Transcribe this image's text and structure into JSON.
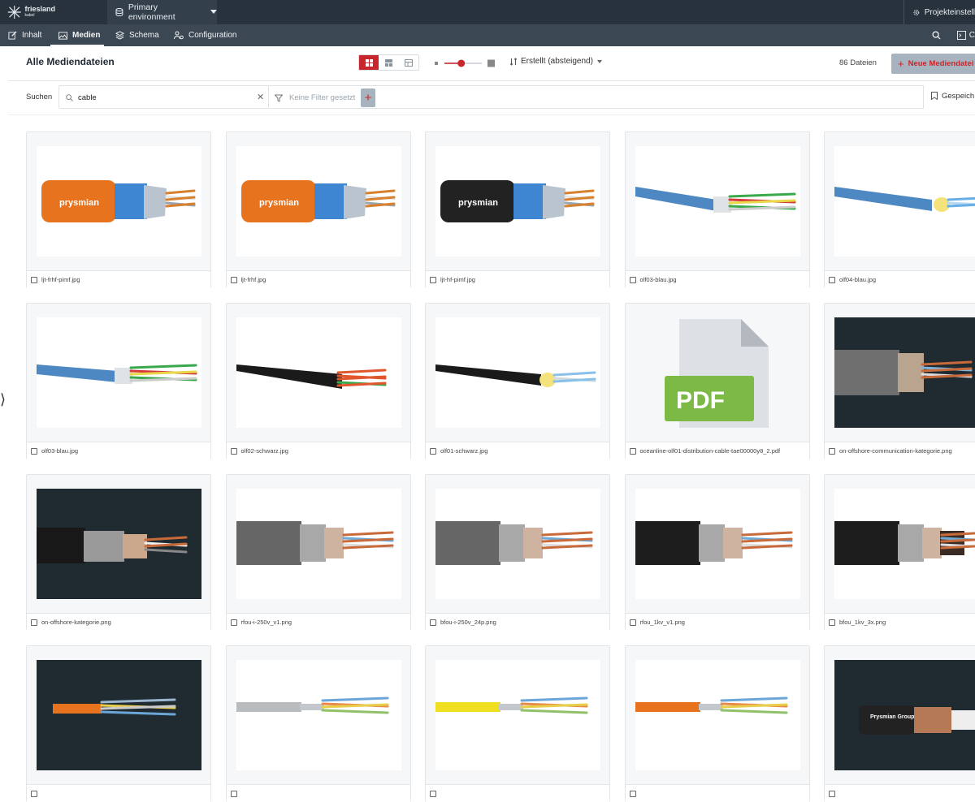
{
  "topbar": {
    "logo_name": "friesland",
    "logo_sub": "kabel",
    "environment": "Primary environment",
    "project_settings": "Projekteinstell"
  },
  "nav": {
    "items": [
      {
        "label": "Inhalt",
        "icon": "edit-icon"
      },
      {
        "label": "Medien",
        "icon": "image-icon",
        "active": true
      },
      {
        "label": "Schema",
        "icon": "layers-icon"
      },
      {
        "label": "Configuration",
        "icon": "users-settings-icon"
      }
    ],
    "right_label": "C"
  },
  "toolbar": {
    "title": "Alle Mediendateien",
    "sort_label": "Erstellt (absteigend)",
    "count": "86 Dateien",
    "new_button": "Neue Mediendatei l",
    "slider_level": 0.45,
    "active_view": "grid"
  },
  "search": {
    "label": "Suchen",
    "value": "cable",
    "filter_placeholder": "Keine Filter gesetzt",
    "saved_label": "Gespeich"
  },
  "colors": {
    "accent": "#c9252c",
    "topbar": "#27323d",
    "navbar": "#3b4753"
  },
  "media": [
    {
      "name": "ljt-frhf-pimf.jpg",
      "kind": "orange-prysmian"
    },
    {
      "name": "ljt-frhf.jpg",
      "kind": "orange-prysmian2"
    },
    {
      "name": "ljt-hf-pimf.jpg",
      "kind": "black-prysmian"
    },
    {
      "name": "olf03-blau.jpg",
      "kind": "blue-fiber"
    },
    {
      "name": "olf04-blau.jpg",
      "kind": "blue-fiber-yellow"
    },
    {
      "name": "olf03-blau.jpg",
      "kind": "blue-fiber-small"
    },
    {
      "name": "olf02-schwarz.jpg",
      "kind": "black-orange"
    },
    {
      "name": "olf01-schwarz.jpg",
      "kind": "black-yellow"
    },
    {
      "name": "oceanline-olf01-distribution-cable-tae00000y8_2.pdf",
      "kind": "pdf"
    },
    {
      "name": "on-offshore-communication-kategorie.png",
      "kind": "dark-multi"
    },
    {
      "name": "on-offshore-kategorie.png",
      "kind": "dark-black"
    },
    {
      "name": "rfou-i-250v_v1.png",
      "kind": "grey-copper"
    },
    {
      "name": "bfou-i-250v_24p.png",
      "kind": "grey-copper2"
    },
    {
      "name": "rfou_1kv_v1.png",
      "kind": "black-copper"
    },
    {
      "name": "bfou_1kv_3x.png",
      "kind": "black-three"
    },
    {
      "name": "",
      "kind": "dark-orange-lan"
    },
    {
      "name": "",
      "kind": "grey-lan"
    },
    {
      "name": "",
      "kind": "yellow-lan"
    },
    {
      "name": "",
      "kind": "orange-lan"
    },
    {
      "name": "",
      "kind": "dark-prysmian-group"
    }
  ],
  "pdf_label": "PDF",
  "thumb_labels": {
    "prysmian": "prysmian",
    "prysmian_group": "Prysmian Group"
  }
}
